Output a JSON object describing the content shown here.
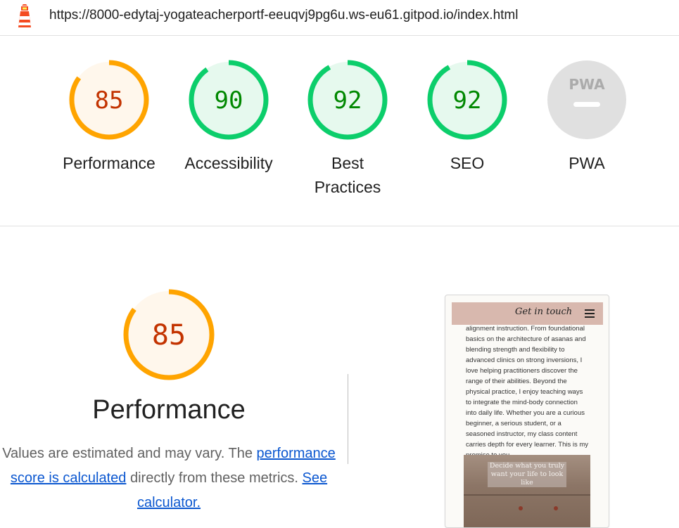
{
  "header": {
    "url": "https://8000-edytaj-yogateacherportf-eeuqvj9pg6u.ws-eu61.gitpod.io/index.html",
    "logo_icon": "lighthouse-icon"
  },
  "colors": {
    "average_ring": "#ffa400",
    "average_fill": "#fff7ec",
    "average_text": "#c33300",
    "pass_ring": "#0cce6b",
    "pass_fill": "#e6f9ee",
    "pass_text": "#008800",
    "pwa_fill": "#e0e0e0",
    "pwa_text": "#ababab"
  },
  "scores": [
    {
      "id": "performance",
      "score": 85,
      "label": "Performance",
      "status": "average"
    },
    {
      "id": "accessibility",
      "score": 90,
      "label": "Accessibility",
      "status": "pass"
    },
    {
      "id": "best-practices",
      "score": 92,
      "label_line1": "Best",
      "label_line2": "Practices",
      "status": "pass"
    },
    {
      "id": "seo",
      "score": 92,
      "label": "SEO",
      "status": "pass"
    },
    {
      "id": "pwa",
      "badge": "PWA",
      "label": "PWA",
      "status": "na"
    }
  ],
  "performance_section": {
    "score": 85,
    "title": "Performance",
    "desc_part1": "Values are estimated and may vary. The ",
    "link1": "performance score is calculated",
    "desc_part2": " directly from these metrics. ",
    "link2": "See calculator."
  },
  "screenshot": {
    "nav_title": "Get in touch",
    "menu_icon": "hamburger-menu-icon",
    "body_text": "alignment instruction. From foundational basics on the architecture of asanas and blending strength and flexibility to advanced clinics on strong inversions, I love helping practitioners discover the range of their abilities. Beyond the physical practice, I enjoy teaching ways to integrate the mind-body connection into daily life. Whether you are a curious beginner, a serious student, or a seasoned instructor, my class content carries depth for every learner. This is my promise to you.",
    "image_caption": "Decide what you truly want your life to look like"
  }
}
